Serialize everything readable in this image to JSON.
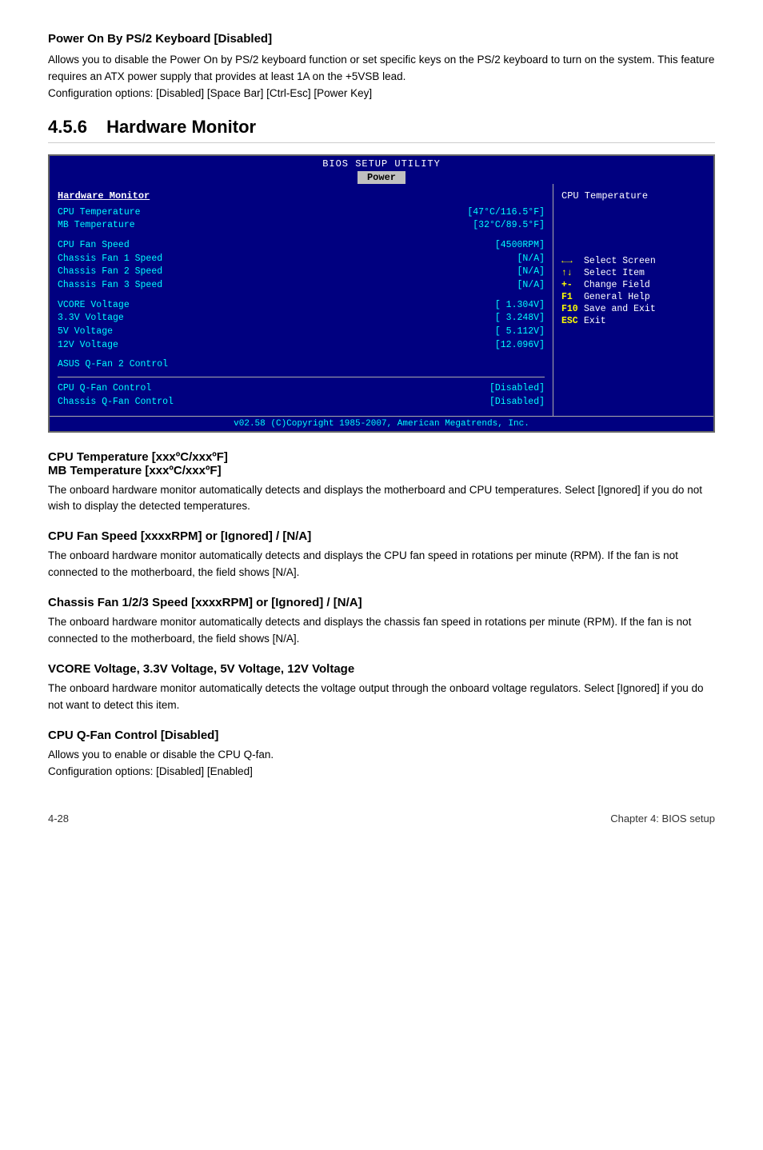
{
  "top_section": {
    "title": "Power On By PS/2 Keyboard [Disabled]",
    "body": "Allows you to disable the Power On by PS/2 keyboard function or set specific keys on the PS/2 keyboard to turn on the system. This feature requires an ATX power supply that provides at least 1A on the +5VSB lead.\nConfiguration options: [Disabled] [Space Bar] [Ctrl-Esc] [Power Key]"
  },
  "hardware_monitor_heading": {
    "num": "4.5.6",
    "label": "Hardware Monitor"
  },
  "bios": {
    "title": "BIOS SETUP UTILITY",
    "active_tab": "Power",
    "left_section_label": "Hardware Monitor",
    "rows": [
      {
        "label": "CPU Temperature",
        "value": "[47°C/116.5°F]"
      },
      {
        "label": "MB Temperature",
        "value": "[32°C/89.5°F]"
      },
      {
        "label": "",
        "value": ""
      },
      {
        "label": "CPU Fan Speed",
        "value": "[4500RPM]"
      },
      {
        "label": "Chassis Fan 1 Speed",
        "value": "[N/A]"
      },
      {
        "label": "Chassis Fan 2 Speed",
        "value": "[N/A]"
      },
      {
        "label": "Chassis Fan 3 Speed",
        "value": "[N/A]"
      },
      {
        "label": "",
        "value": ""
      },
      {
        "label": "VCORE Voltage",
        "value": "[ 1.304V]"
      },
      {
        "label": "3.3V  Voltage",
        "value": "[ 3.248V]"
      },
      {
        "label": "5V    Voltage",
        "value": "[ 5.112V]"
      },
      {
        "label": "12V   Voltage",
        "value": "[12.096V]"
      },
      {
        "label": "",
        "value": ""
      },
      {
        "label": "ASUS Q-Fan 2 Control",
        "value": ""
      },
      {
        "label": "CPU Q-Fan Control",
        "value": "[Disabled]"
      },
      {
        "label": "Chassis Q-Fan Control",
        "value": "[Disabled]"
      }
    ],
    "right_title": "CPU Temperature",
    "keys": [
      {
        "key": "←→",
        "desc": "Select Screen"
      },
      {
        "key": "↑↓",
        "desc": "Select Item"
      },
      {
        "key": "+-",
        "desc": "Change Field"
      },
      {
        "key": "F1",
        "desc": "General Help"
      },
      {
        "key": "F10",
        "desc": "Save and Exit"
      },
      {
        "key": "ESC",
        "desc": "Exit"
      }
    ],
    "footer": "v02.58 (C)Copyright 1985-2007, American Megatrends, Inc."
  },
  "subsections": [
    {
      "title": "CPU Temperature [xxxºC/xxxºF]\nMB Temperature [xxxºC/xxxºF]",
      "body": "The onboard hardware monitor automatically detects and displays the motherboard and CPU temperatures. Select [Ignored] if you do not wish to display the detected temperatures."
    },
    {
      "title": "CPU Fan Speed [xxxxRPM] or [Ignored] / [N/A]",
      "body": "The onboard hardware monitor automatically detects and displays the CPU fan speed in rotations per minute (RPM). If the fan is not connected to the motherboard, the field shows [N/A]."
    },
    {
      "title": "Chassis Fan 1/2/3 Speed [xxxxRPM] or [Ignored] / [N/A]",
      "body": "The onboard hardware monitor automatically detects and displays the chassis fan speed in rotations per minute (RPM). If the fan is not connected to the motherboard, the field shows [N/A]."
    },
    {
      "title": "VCORE Voltage, 3.3V Voltage, 5V Voltage, 12V Voltage",
      "body": "The onboard hardware monitor automatically detects the voltage output through the onboard voltage regulators. Select [Ignored] if you do not want to detect this item."
    },
    {
      "title": "CPU Q-Fan Control [Disabled]",
      "body": "Allows you to enable or disable the CPU Q-fan.\nConfiguration options: [Disabled] [Enabled]"
    }
  ],
  "footer": {
    "left": "4-28",
    "right": "Chapter 4: BIOS setup"
  }
}
